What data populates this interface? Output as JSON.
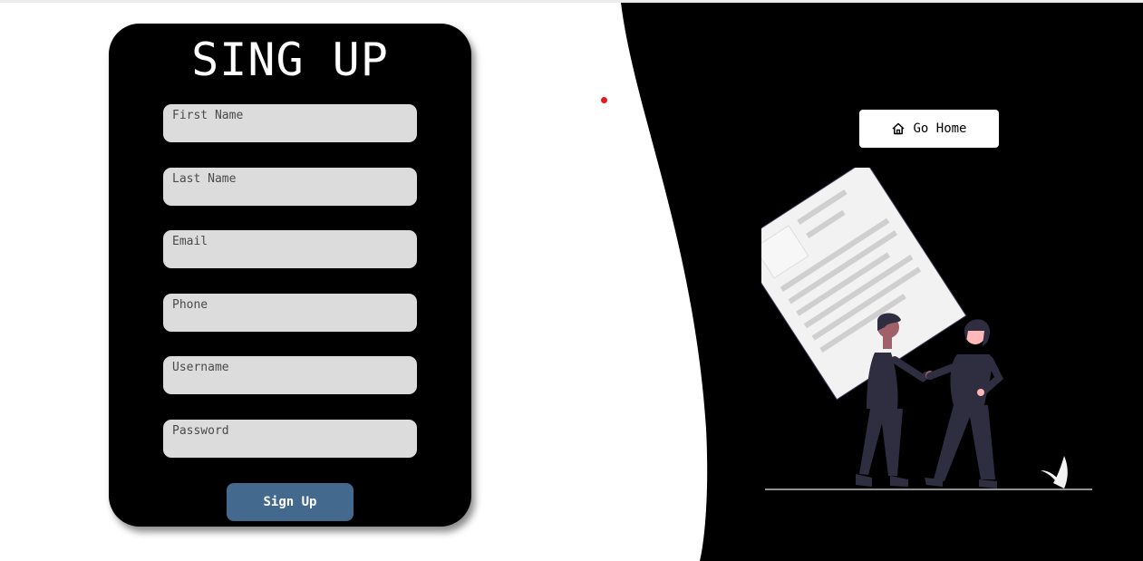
{
  "form": {
    "title": "SING UP",
    "fields": [
      {
        "placeholder": "First Name",
        "value": ""
      },
      {
        "placeholder": "Last Name",
        "value": ""
      },
      {
        "placeholder": "Email",
        "value": ""
      },
      {
        "placeholder": "Phone",
        "value": ""
      },
      {
        "placeholder": "Username",
        "value": ""
      },
      {
        "placeholder": "Password",
        "value": ""
      }
    ],
    "submit_label": "Sign Up"
  },
  "nav": {
    "go_home_label": "Go Home",
    "go_home_icon": "home-icon"
  },
  "colors": {
    "panel": "#000000",
    "input_bg": "#dcdcdc",
    "button_bg": "#44698f",
    "accent_dot": "#e31b1b"
  }
}
